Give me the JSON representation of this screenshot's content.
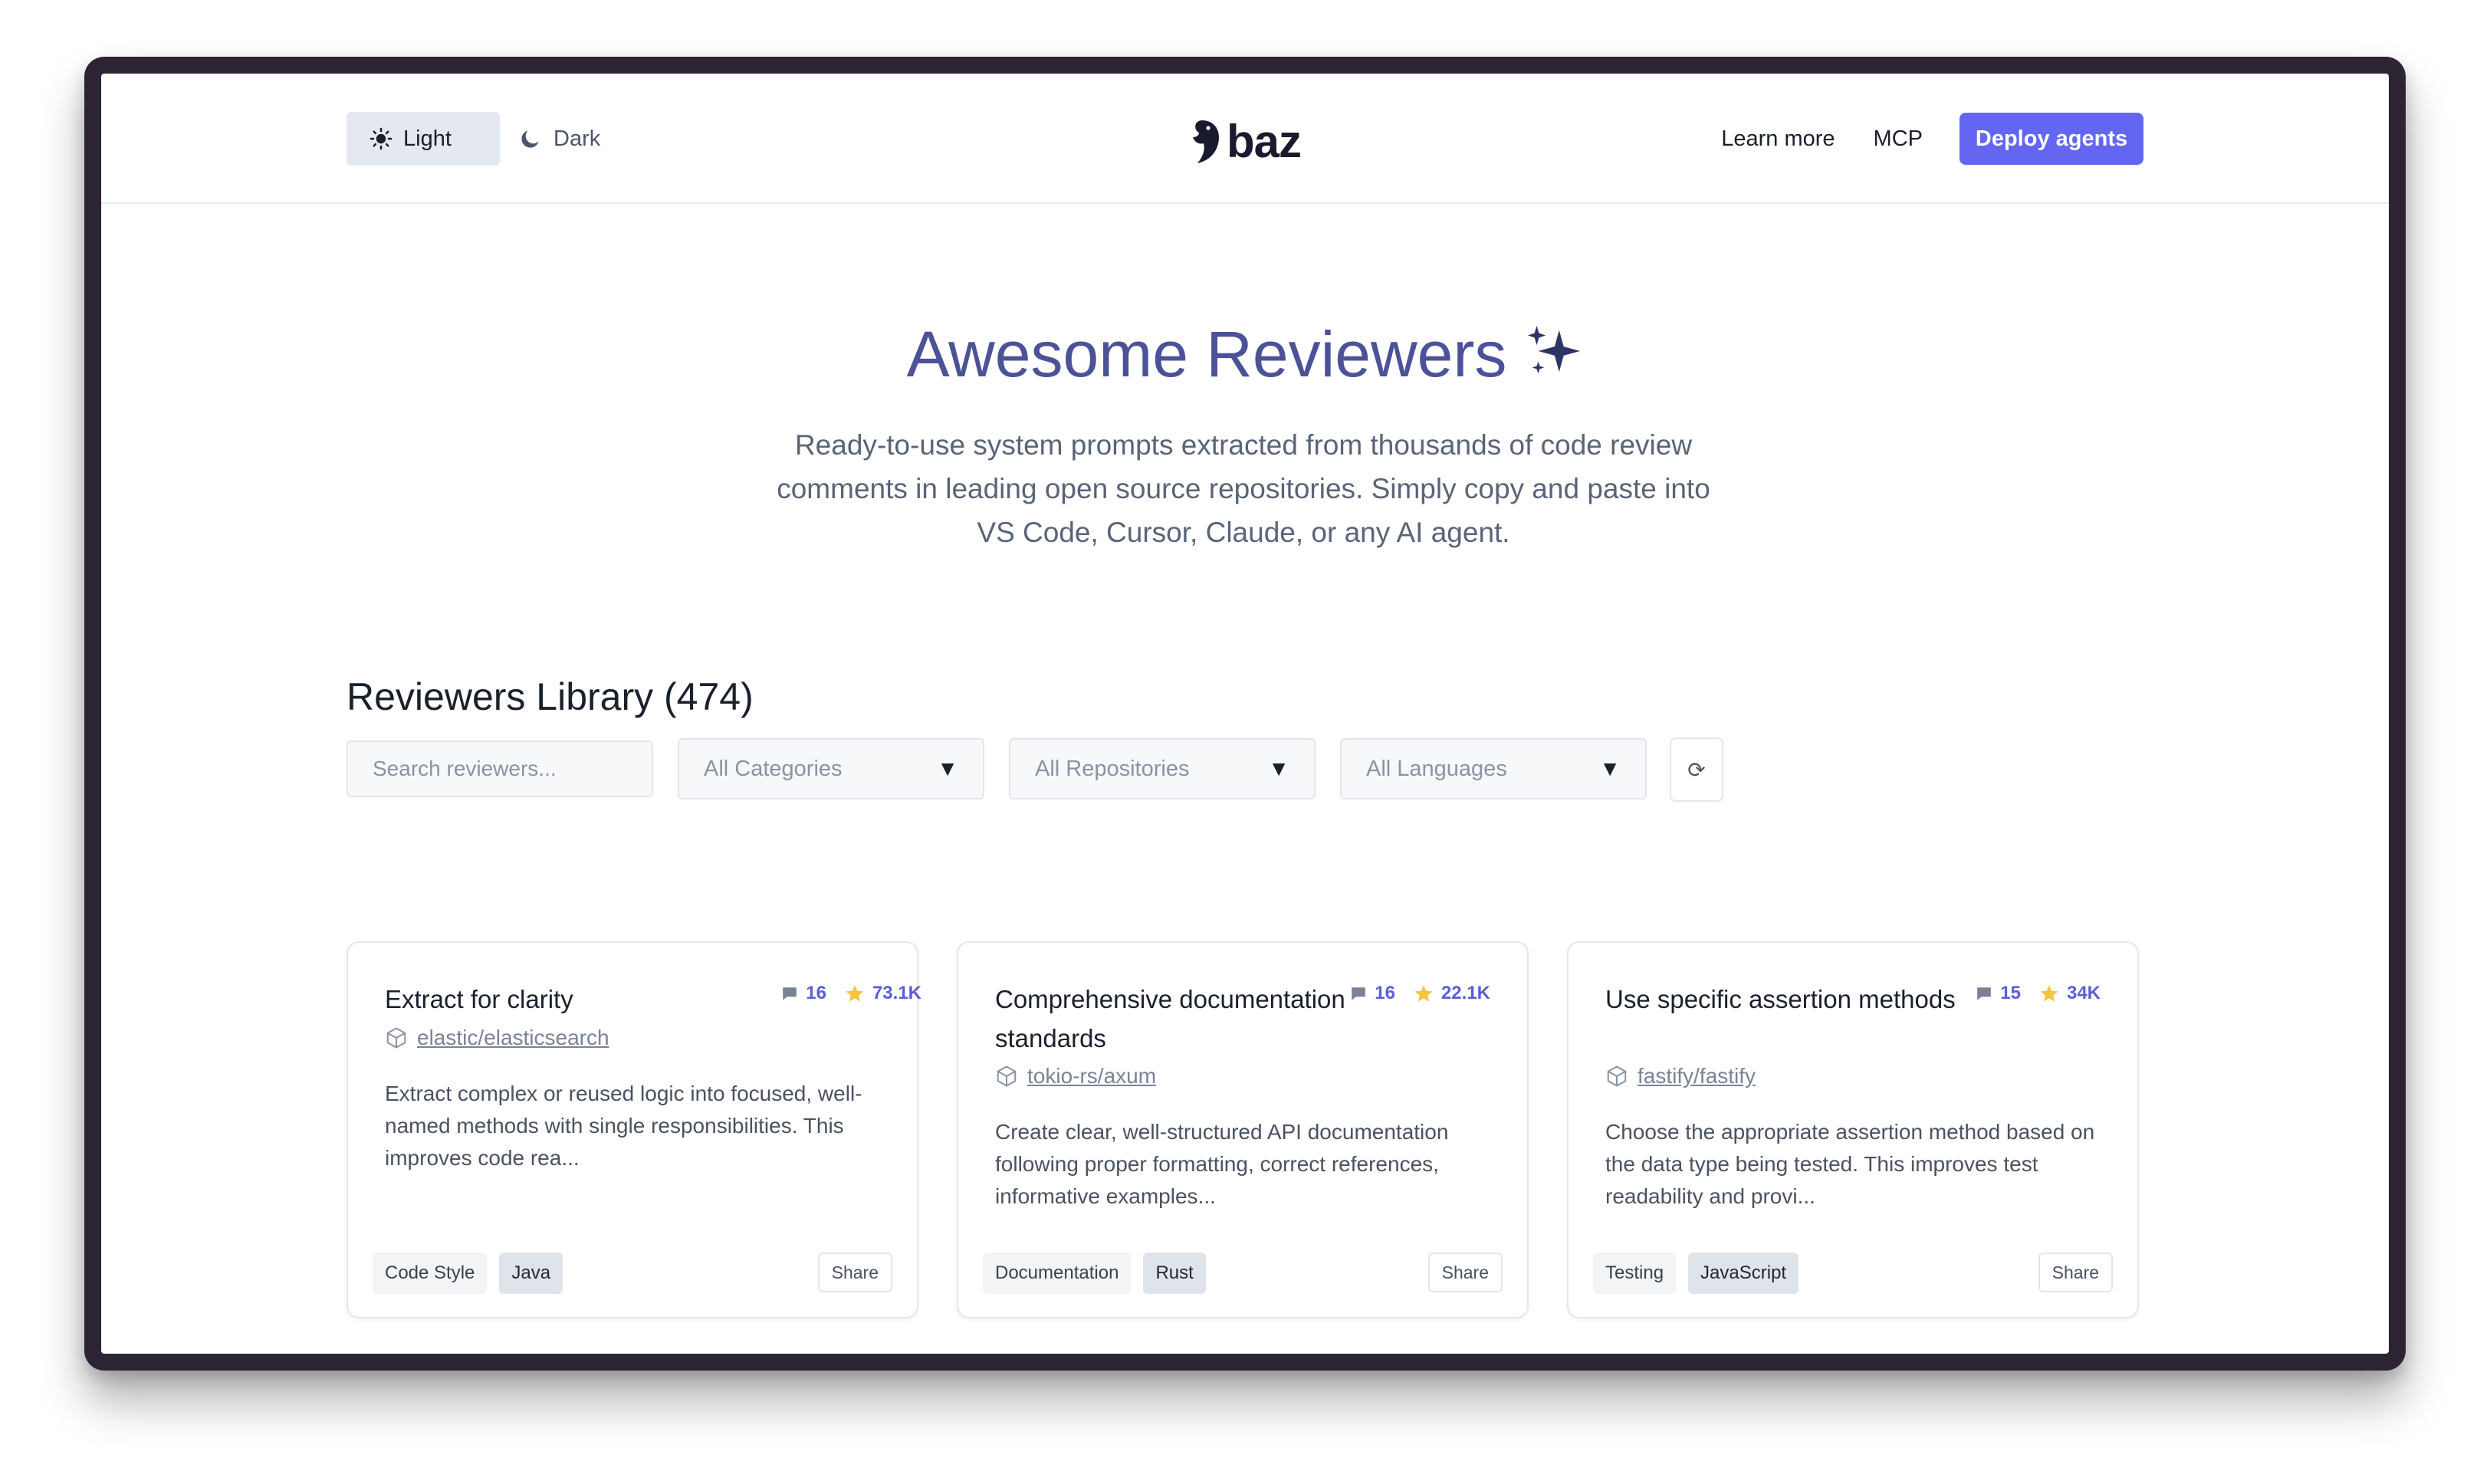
{
  "header": {
    "theme_light": "Light",
    "theme_dark": "Dark",
    "logo_text": "baz",
    "nav_learn_more": "Learn more",
    "nav_mcp": "MCP",
    "deploy_button": "Deploy agents"
  },
  "hero": {
    "title": "Awesome Reviewers",
    "subtitle": "Ready-to-use system prompts extracted from thousands of code review comments in leading open source repositories. Simply copy and paste into VS Code, Cursor, Claude, or any AI agent."
  },
  "library": {
    "title": "Reviewers Library (474)",
    "search_placeholder": "Search reviewers...",
    "filter_categories": "All Categories",
    "filter_repositories": "All Repositories",
    "filter_languages": "All Languages",
    "caret": "▼",
    "reset_icon": "⟳"
  },
  "cards": [
    {
      "title": "Extract for clarity",
      "comments": "16",
      "stars": "73.1K",
      "repo": "elastic/elasticsearch",
      "description": "Extract complex or reused logic into focused, well-named methods with single responsibilities. This improves code rea...",
      "category": "Code Style",
      "language": "Java",
      "share": "Share"
    },
    {
      "title": "Comprehensive documentation standards",
      "comments": "16",
      "stars": "22.1K",
      "repo": "tokio-rs/axum",
      "description": "Create clear, well-structured API documentation following proper formatting, correct references, informative examples...",
      "category": "Documentation",
      "language": "Rust",
      "share": "Share"
    },
    {
      "title": "Use specific assertion methods",
      "comments": "15",
      "stars": "34K",
      "repo": "fastify/fastify",
      "description": "Choose the appropriate assertion method based on the data type being tested. This improves test readability and provi...",
      "category": "Testing",
      "language": "JavaScript",
      "share": "Share"
    }
  ],
  "colors": {
    "accent": "#6366f1",
    "title": "#4c5298",
    "frame": "#2c2333",
    "star": "#f5c542"
  }
}
